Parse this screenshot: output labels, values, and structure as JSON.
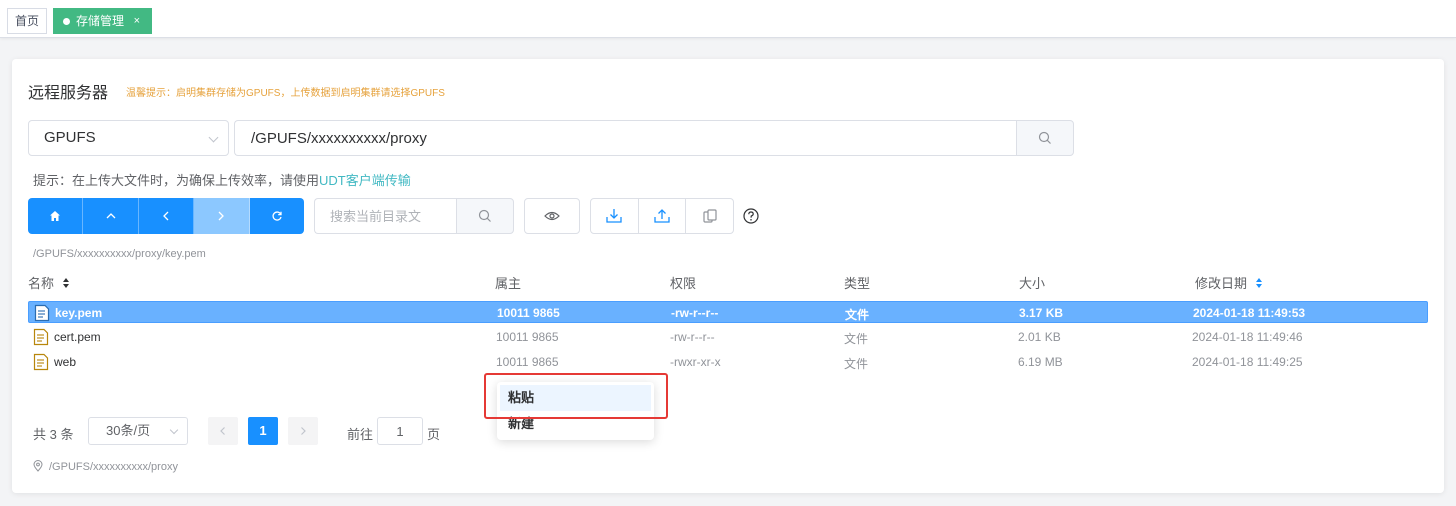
{
  "tabs": {
    "home": "首页",
    "active": "存储管理",
    "close": "×"
  },
  "card": {
    "title": "远程服务器",
    "notice": "温馨提示：启明集群存储为GPUFS，上传数据到启明集群请选择GPUFS"
  },
  "pathbar": {
    "storage": "GPUFS",
    "path": "/GPUFS/xxxxxxxxxx/proxy"
  },
  "tip": {
    "text": "提示：在上传大文件时，为确保上传效率，请使用",
    "link": "UDT客户端传输"
  },
  "toolbar": {
    "search_placeholder": "搜索当前目录文"
  },
  "current_path": "/GPUFS/xxxxxxxxxx/proxy/key.pem",
  "table": {
    "headers": {
      "name": "名称",
      "owner": "属主",
      "perm": "权限",
      "type": "类型",
      "size": "大小",
      "mtime": "修改日期"
    },
    "rows": [
      {
        "name": "key.pem",
        "owner": "10011 9865",
        "perm": "-rw-r--r--",
        "type": "文件",
        "size": "3.17 KB",
        "mtime": "2024-01-18 11:49:53",
        "selected": true
      },
      {
        "name": "cert.pem",
        "owner": "10011 9865",
        "perm": "-rw-r--r--",
        "type": "文件",
        "size": "2.01 KB",
        "mtime": "2024-01-18 11:49:46",
        "selected": false
      },
      {
        "name": "web",
        "owner": "10011 9865",
        "perm": "-rwxr-xr-x",
        "type": "文件",
        "size": "6.19 MB",
        "mtime": "2024-01-18 11:49:25",
        "selected": false
      }
    ]
  },
  "pagination": {
    "total": "共 3 条",
    "page_size": "30条/页",
    "current": "1",
    "goto_label": "前往",
    "goto_value": "1",
    "page_suffix": "页"
  },
  "footer_path": "/GPUFS/xxxxxxxxxx/proxy",
  "context_menu": {
    "paste": "粘贴",
    "new": "新建"
  },
  "colors": {
    "primary": "#1890ff",
    "tab_active": "#42b983",
    "selected_row": "#69b1ff",
    "notice": "#e6a23c",
    "highlight": "#e53935"
  }
}
